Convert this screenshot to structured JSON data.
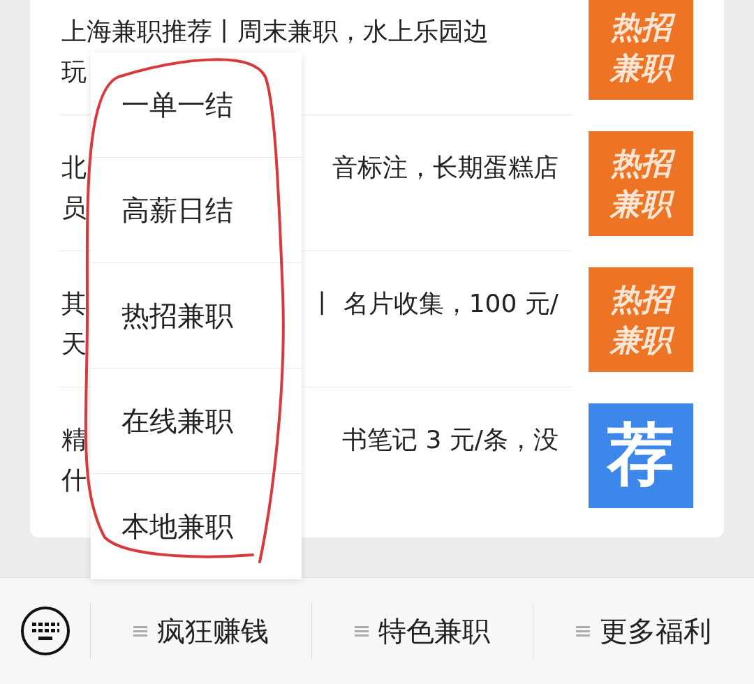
{
  "articles": [
    {
      "line_1_left": "上海兼职推荐丨周末兼职，水上乐园边",
      "line_2": "玩",
      "badge": {
        "kind": "hot",
        "lines": [
          "热招",
          "兼职"
        ]
      }
    },
    {
      "line_1_left": "北",
      "line_1_right": "音标注，长期蛋糕店",
      "line_2": "员",
      "badge": {
        "kind": "hot",
        "lines": [
          "热招",
          "兼职"
        ]
      }
    },
    {
      "line_1_left": "其",
      "line_1_right": "丨 名片收集，100 元/",
      "line_2": "天",
      "badge": {
        "kind": "hot",
        "lines": [
          "热招",
          "兼职"
        ]
      }
    },
    {
      "line_1_left": "精",
      "line_1_right": "书笔记 3 元/条，没",
      "line_2": "什",
      "badge": {
        "kind": "recommend",
        "lines": [
          "荐"
        ]
      }
    }
  ],
  "popup_menu": [
    "一单一结",
    "高薪日结",
    "热招兼职",
    "在线兼职",
    "本地兼职"
  ],
  "bottom_menu": [
    "疯狂赚钱",
    "特色兼职",
    "更多福利"
  ]
}
